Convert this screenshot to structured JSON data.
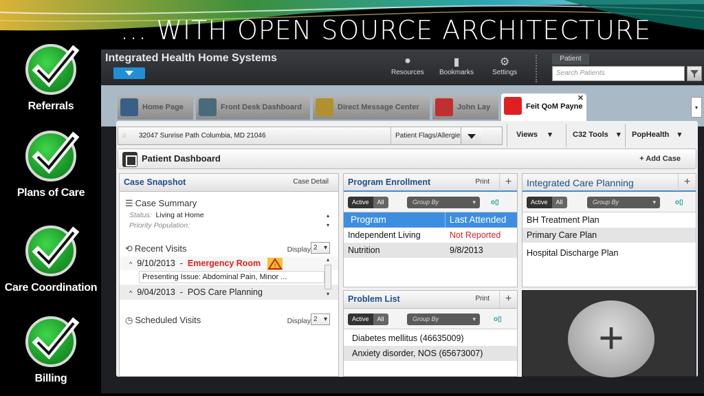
{
  "slide": {
    "title": "... WITH OPEN SOURCE ARCHITECTURE",
    "checklist": [
      "Referrals",
      "Plans of Care",
      "Care Coordination",
      "Billing"
    ]
  },
  "app": {
    "name": "Integrated Health Home Systems",
    "toolbar": {
      "resources": "Resources",
      "bookmarks": "Bookmarks",
      "settings": "Settings",
      "patient_label": "Patient",
      "search_placeholder": "Search Patients"
    },
    "tabs": [
      "Home Page",
      "Front Desk Dashboard",
      "Direct Message Center",
      "John Lay",
      "Feit QoM Payne"
    ],
    "address": "32047 Sunrise Path Columbia,  MD  21046",
    "flags_label": "Patient Flags/Allergies",
    "menus": [
      "Views",
      "C32 Tools",
      "PopHealth"
    ],
    "dashboard_title": "Patient Dashboard",
    "add_case": "+ Add Case",
    "case_snapshot": {
      "title": "Case Snapshot",
      "detail": "Case Detail",
      "summary_title": "Case Summary",
      "status_label": "Status:",
      "status_value": "Living at Home",
      "priority_label": "Priority Population:",
      "recent_visits": "Recent Visits",
      "display_label": "Display",
      "display_value": "2",
      "visit1_date": "9/10/2013",
      "visit1_sep": "-",
      "visit1_type": "Emergency Room",
      "visit1_detail": "Presenting Issue: Abdominal Pain, Minor ...",
      "visit2_date": "9/04/2013",
      "visit2_sep": "-",
      "visit2_type": "POS Care Planning",
      "scheduled_visits": "Scheduled Visits"
    },
    "filters": {
      "active": "Active",
      "all": "All",
      "group_by": "Group By",
      "print": "Print"
    },
    "program_enrollment": {
      "title": "Program Enrollment",
      "col_program": "Program",
      "col_last": "Last Attended",
      "rows": [
        {
          "program": "Independent Living",
          "last": "Not Reported"
        },
        {
          "program": "Nutrition",
          "last": "9/8/2013"
        }
      ]
    },
    "problem_list": {
      "title": "Problem List",
      "rows": [
        "Diabetes mellitus (46635009)",
        "Anxiety disorder, NOS (65673007)"
      ]
    },
    "care_planning": {
      "title": "Integrated Care Planning",
      "rows": [
        "BH Treatment Plan",
        "Primary Care Plan",
        "Hospital Discharge Plan"
      ]
    }
  },
  "colors": {
    "accent_blue": "#1f8fd6",
    "header_blue": "#3d8ee0",
    "alert_red": "#e02020",
    "check_green": "#1b9a29"
  }
}
